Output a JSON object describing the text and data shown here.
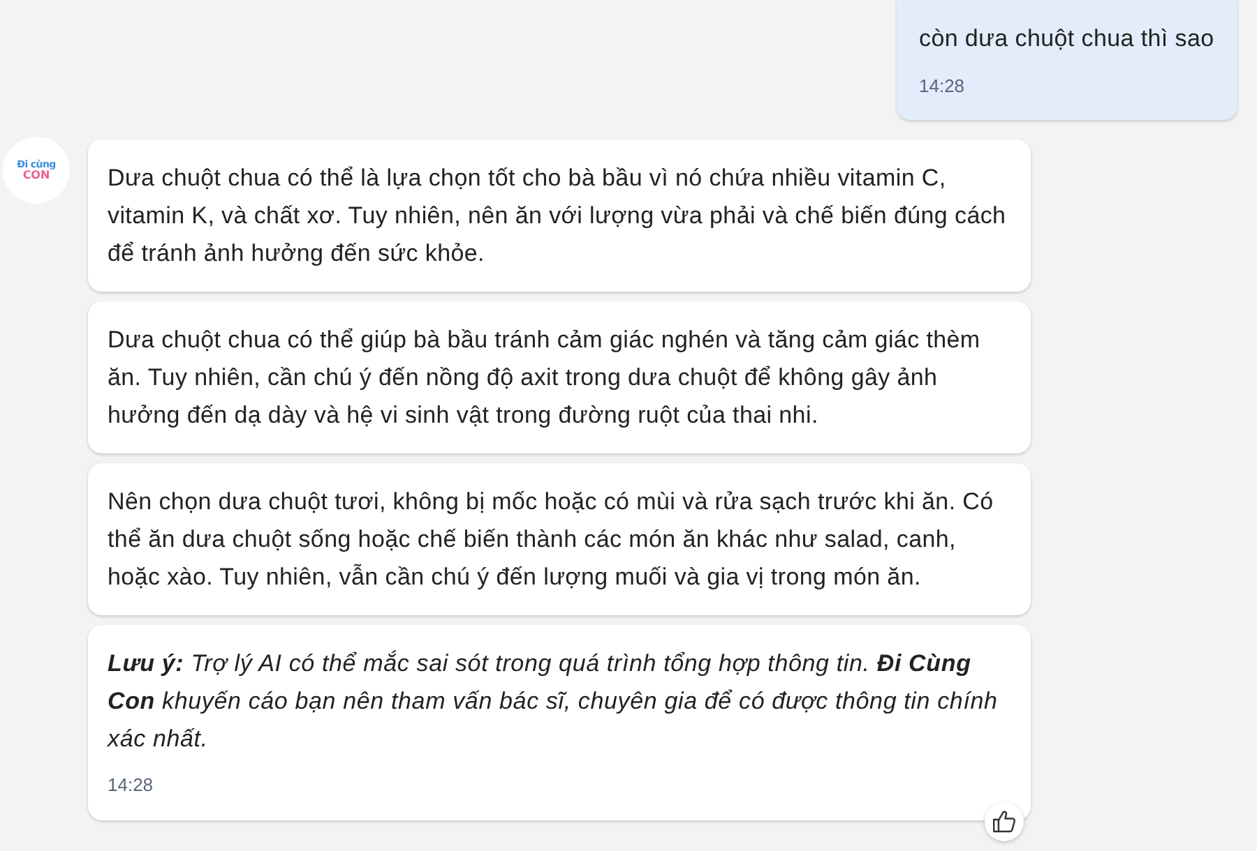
{
  "user_message": {
    "text": "còn dưa chuột chua thì sao",
    "time": "14:28"
  },
  "assistant_reply": {
    "avatar": {
      "line_1": "Đi cùng",
      "line_2": "CON"
    },
    "cards": [
      {
        "kind": "text",
        "text": "Dưa chuột chua có thể là lựa chọn tốt cho bà bầu vì nó chứa nhiều vitamin C, vitamin K, và chất xơ. Tuy nhiên, nên ăn với lượng vừa phải và chế biến đúng cách để tránh ảnh hưởng đến sức khỏe."
      },
      {
        "kind": "text",
        "text": "Dưa chuột chua có thể giúp bà bầu tránh cảm giác nghén và tăng cảm giác thèm ăn. Tuy nhiên, cần chú ý đến nồng độ axit trong dưa chuột để không gây ảnh hưởng đến dạ dày và hệ vi sinh vật trong đường ruột của thai nhi."
      },
      {
        "kind": "text",
        "text": "Nên chọn dưa chuột tươi, không bị mốc hoặc có mùi và rửa sạch trước khi ăn. Có thể ăn dưa chuột sống hoặc chế biến thành các món ăn khác như salad, canh, hoặc xào. Tuy nhiên, vẫn cần chú ý đến lượng muối và gia vị trong món ăn."
      },
      {
        "kind": "note",
        "text": "**Lưu ý:** Trợ lý AI có thể mắc sai sót trong quá trình tổng hợp thông tin. **Đi Cùng Con** khuyến cáo bạn nên tham vấn bác sĩ, chuyên gia để có được thông tin chính xác nhất.",
        "time": "14:28"
      }
    ]
  }
}
